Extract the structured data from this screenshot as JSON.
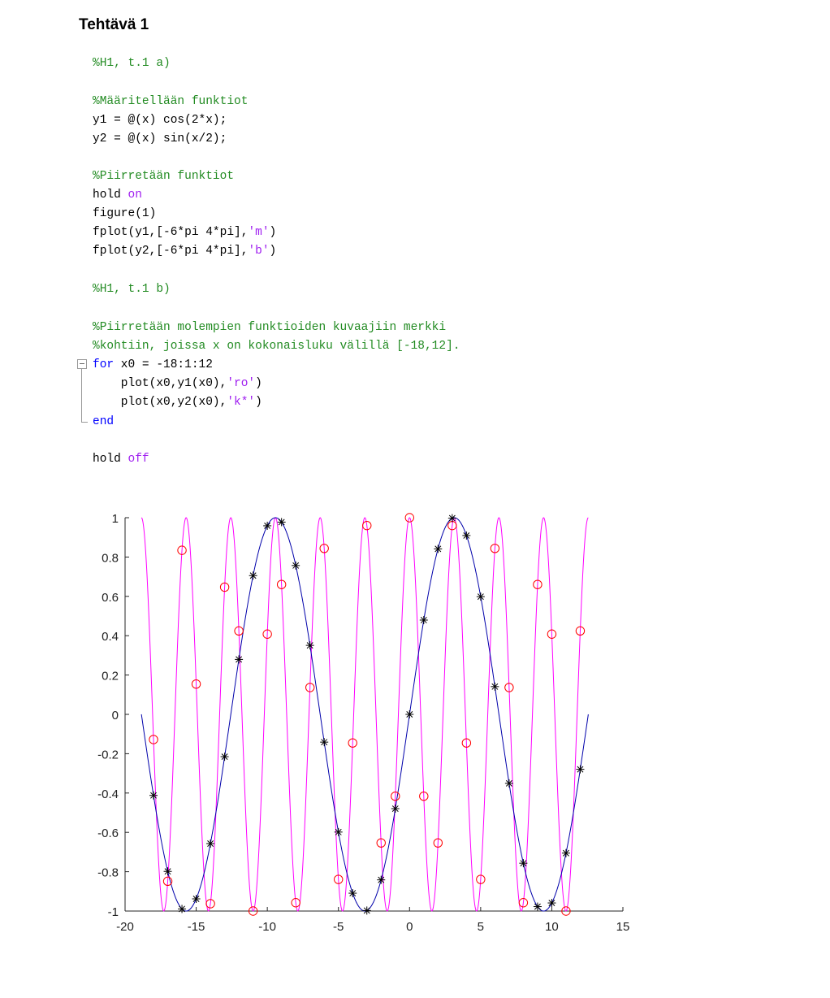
{
  "heading": "Tehtävä 1",
  "code": {
    "l1": "%H1, t.1 a)",
    "l2": "%Määritellään funktiot",
    "l3": "y1 = @(x) cos(2*x);",
    "l4": "y2 = @(x) sin(x/2);",
    "l5": "%Piirretään funktiot",
    "l6_a": "hold ",
    "l6_b": "on",
    "l7": "figure(1)",
    "l8_a": "fplot(y1,[-6*pi 4*pi],",
    "l8_b": "'m'",
    "l8_c": ")",
    "l9_a": "fplot(y2,[-6*pi 4*pi],",
    "l9_b": "'b'",
    "l9_c": ")",
    "l10": "%H1, t.1 b)",
    "l11": "%Piirretään molempien funktioiden kuvaajiin merkki",
    "l12": "%kohtiin, joissa x on kokonaisluku välillä [-18,12].",
    "l13_a": "for",
    "l13_b": " x0 = -18:1:12",
    "l14_a": "    plot(x0,y1(x0),",
    "l14_b": "'ro'",
    "l14_c": ")",
    "l15_a": "    plot(x0,y2(x0),",
    "l15_b": "'k*'",
    "l15_c": ")",
    "l16": "end",
    "l17_a": "hold ",
    "l17_b": "off"
  },
  "chart_data": {
    "type": "line",
    "title": "",
    "xlabel": "",
    "ylabel": "",
    "xlim": [
      -20,
      15
    ],
    "ylim": [
      -1,
      1
    ],
    "grid": false,
    "x_ticks": [
      "-20",
      "-15",
      "-10",
      "-5",
      "0",
      "5",
      "10",
      "15"
    ],
    "y_ticks": [
      "1",
      "0.8",
      "0.6",
      "0.4",
      "0.2",
      "0",
      "-0.2",
      "-0.4",
      "-0.6",
      "-0.8",
      "-1"
    ],
    "series": [
      {
        "function": "cos(2*x)",
        "x_range": [
          -18.8496,
          12.5664
        ],
        "color": "#ff00ff",
        "style": "line"
      },
      {
        "function": "sin(x/2)",
        "x_range": [
          -18.8496,
          12.5664
        ],
        "color": "#0000aa",
        "style": "line"
      },
      {
        "function": "cos(2*x)",
        "x": [
          -18,
          -17,
          -16,
          -15,
          -14,
          -13,
          -12,
          -11,
          -10,
          -9,
          -8,
          -7,
          -6,
          -5,
          -4,
          -3,
          -2,
          -1,
          0,
          1,
          2,
          3,
          4,
          5,
          6,
          7,
          8,
          9,
          10,
          11,
          12
        ],
        "marker": "circle",
        "color": "#ff0000"
      },
      {
        "function": "sin(x/2)",
        "x": [
          -18,
          -17,
          -16,
          -15,
          -14,
          -13,
          -12,
          -11,
          -10,
          -9,
          -8,
          -7,
          -6,
          -5,
          -4,
          -3,
          -2,
          -1,
          0,
          1,
          2,
          3,
          4,
          5,
          6,
          7,
          8,
          9,
          10,
          11,
          12
        ],
        "marker": "asterisk",
        "color": "#000000"
      }
    ]
  }
}
